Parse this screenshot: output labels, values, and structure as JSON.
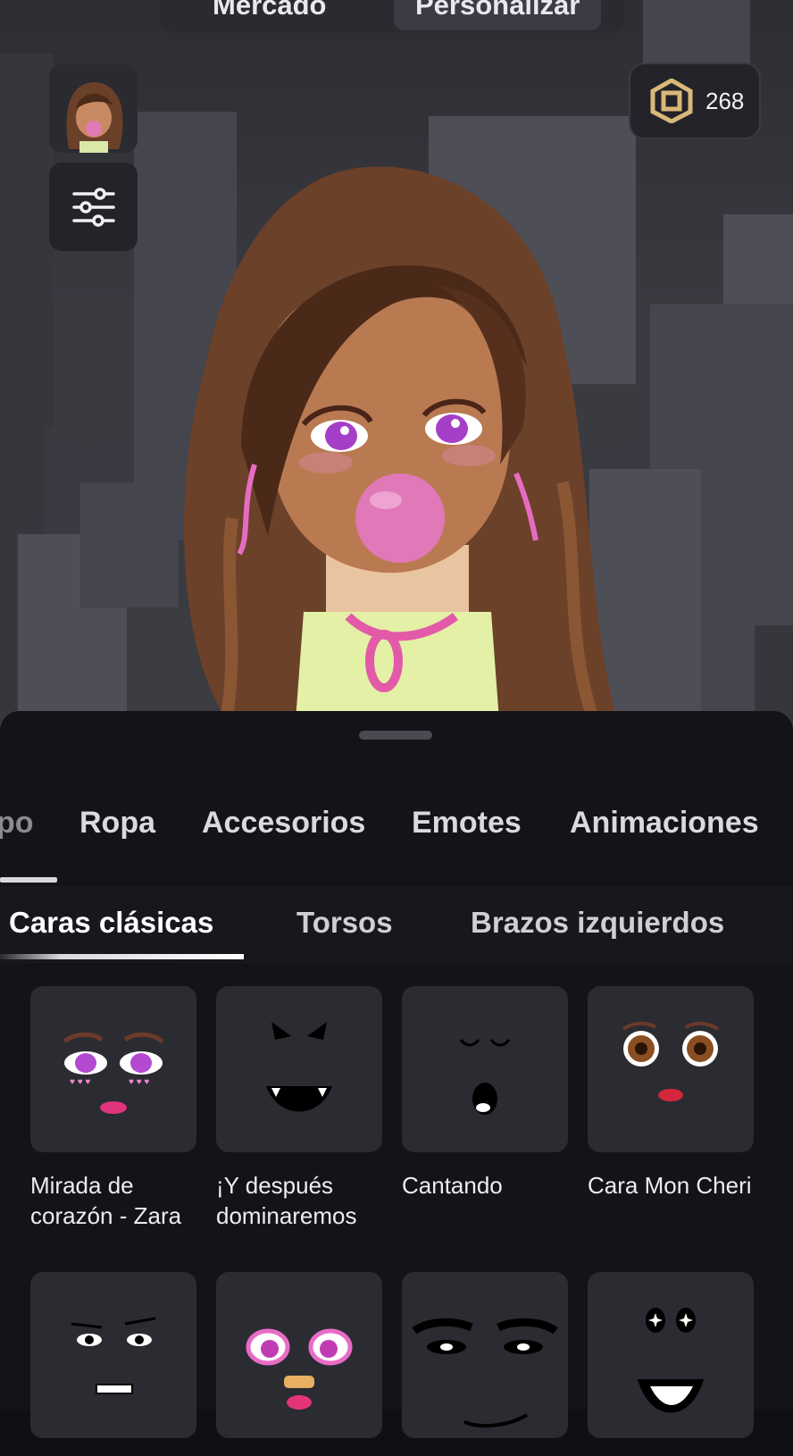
{
  "header": {
    "tabs": [
      {
        "label": "Mercado",
        "active": false
      },
      {
        "label": "Personalizar",
        "active": true
      }
    ],
    "back_icon": "back-arrow-icon"
  },
  "robux": {
    "icon": "robux-icon",
    "amount": "268"
  },
  "side_buttons": {
    "avatar_icon": "avatar-thumbnail",
    "settings_icon": "sliders-icon"
  },
  "categories": [
    {
      "label": "po"
    },
    {
      "label": "Ropa"
    },
    {
      "label": "Accesorios"
    },
    {
      "label": "Emotes"
    },
    {
      "label": "Animaciones"
    }
  ],
  "subcategories": [
    {
      "label": "Caras clásicas",
      "active": true
    },
    {
      "label": "Torsos",
      "active": false
    },
    {
      "label": "Brazos izquierdos",
      "active": false
    }
  ],
  "items": [
    {
      "name": "Mirada de corazón - Zara",
      "icon": "heart-eyes-face-icon"
    },
    {
      "name": "¡Y después dominaremos",
      "icon": "villain-face-icon"
    },
    {
      "name": "Cantando",
      "icon": "singing-face-icon"
    },
    {
      "name": "Cara Mon Cheri",
      "icon": "mon-cheri-face-icon"
    },
    {
      "name": "",
      "icon": "grimace-face-icon"
    },
    {
      "name": "",
      "icon": "pink-eyes-face-icon"
    },
    {
      "name": "",
      "icon": "bold-brows-face-icon"
    },
    {
      "name": "",
      "icon": "starry-smile-face-icon"
    }
  ],
  "colors": {
    "background": "#101014",
    "sheet": "#131318",
    "tile": "#2b2b32",
    "accent_pink": "#e25aa8"
  }
}
